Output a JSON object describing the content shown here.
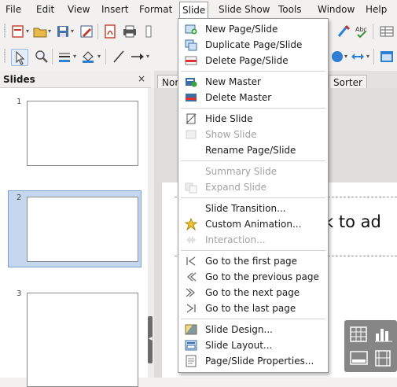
{
  "menubar": {
    "file": "File",
    "edit": "Edit",
    "view": "View",
    "insert": "Insert",
    "format": "Format",
    "slide": "Slide",
    "slideshow": "Slide Show",
    "tools": "Tools",
    "window": "Window",
    "help": "Help"
  },
  "toolbar1": {
    "icons": [
      "new-document-icon",
      "open-folder-icon",
      "save-icon",
      "edit-file-icon",
      "export-pdf-icon",
      "print-icon",
      "autocorrect-icon",
      "spellcheck-icon",
      "table-icon"
    ]
  },
  "toolbar2": {
    "icons": [
      "select-arrow-icon",
      "zoom-icon",
      "line-color-icon",
      "fill-color-icon",
      "line-tool-icon",
      "arrow-line-icon",
      "shapes-icon",
      "double-arrow-icon",
      "table-insert-icon"
    ]
  },
  "slides_pane": {
    "title": "Slides",
    "close": "×",
    "slides": [
      "1",
      "2",
      "3"
    ],
    "selected": "2"
  },
  "workspace": {
    "tab_normal": "Nor",
    "tab_sorter": "Sorter",
    "title_placeholder": "k to ad"
  },
  "slide_menu": {
    "new_page": "New Page/Slide",
    "duplicate_page": "Duplicate Page/Slide",
    "delete_page": "Delete Page/Slide",
    "new_master": "New Master",
    "delete_master": "Delete Master",
    "hide_slide": "Hide Slide",
    "show_slide": "Show Slide",
    "rename_page": "Rename Page/Slide",
    "summary_slide": "Summary Slide",
    "expand_slide": "Expand Slide",
    "slide_transition": "Slide Transition...",
    "custom_animation": "Custom Animation...",
    "interaction": "Interaction...",
    "first_page": "Go to the first page",
    "previous_page": "Go to the previous page",
    "next_page": "Go to the next page",
    "last_page": "Go to the last page",
    "slide_design": "Slide Design...",
    "slide_layout": "Slide Layout...",
    "page_properties": "Page/Slide Properties..."
  },
  "colors": {
    "selection": "#c4d7ee",
    "selection_border": "#7ea0cf",
    "menu_border": "#9a9a9a",
    "disabled_text": "#a2a2a2"
  }
}
